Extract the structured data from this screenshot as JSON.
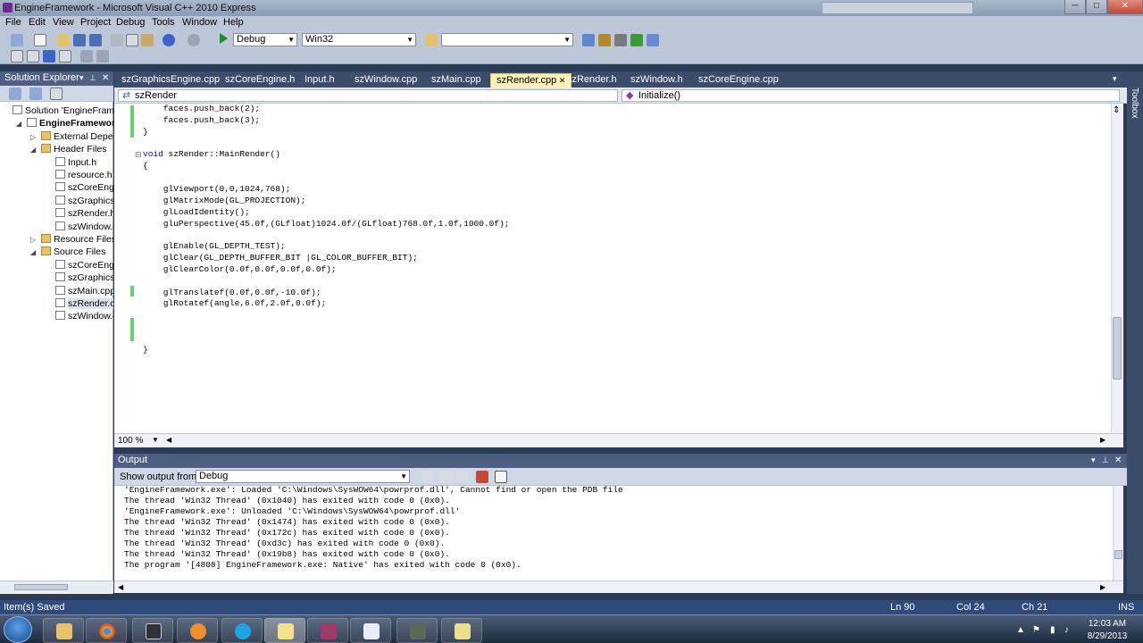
{
  "window": {
    "title": "EngineFramework - Microsoft Visual C++ 2010 Express",
    "min": "─",
    "max": "□",
    "close": "✕"
  },
  "menu": [
    "File",
    "Edit",
    "View",
    "Project",
    "Debug",
    "Tools",
    "Window",
    "Help"
  ],
  "toolbar": {
    "config": "Debug",
    "platform": "Win32",
    "find_value": ""
  },
  "solution_explorer": {
    "title": "Solution Explorer",
    "items": [
      {
        "label": "Solution 'EngineFrame",
        "level": 0,
        "folder": false
      },
      {
        "label": "EngineFramework",
        "level": 1,
        "folder": false
      },
      {
        "label": "External Depen",
        "level": 2,
        "folder": true
      },
      {
        "label": "Header Files",
        "level": 2,
        "folder": true
      },
      {
        "label": "Input.h",
        "level": 3,
        "folder": false
      },
      {
        "label": "resource.h",
        "level": 3,
        "folder": false
      },
      {
        "label": "szCoreEngi",
        "level": 3,
        "folder": false
      },
      {
        "label": "szGraphicsE",
        "level": 3,
        "folder": false
      },
      {
        "label": "szRender.h",
        "level": 3,
        "folder": false
      },
      {
        "label": "szWindow.h",
        "level": 3,
        "folder": false
      },
      {
        "label": "Resource Files",
        "level": 2,
        "folder": true
      },
      {
        "label": "Source Files",
        "level": 2,
        "folder": true
      },
      {
        "label": "szCoreEngi",
        "level": 3,
        "folder": false
      },
      {
        "label": "szGraphicsE",
        "level": 3,
        "folder": false
      },
      {
        "label": "szMain.cpp",
        "level": 3,
        "folder": false
      },
      {
        "label": "szRender.cp",
        "level": 3,
        "folder": false
      },
      {
        "label": "szWindow.c",
        "level": 3,
        "folder": false
      }
    ]
  },
  "tabs": [
    "szGraphicsEngine.cpp",
    "szCoreEngine.h",
    "Input.h",
    "szWindow.cpp",
    "szMain.cpp",
    "szRender.cpp",
    "szRender.h",
    "szWindow.h",
    "szCoreEngine.cpp"
  ],
  "active_tab": "szRender.cpp",
  "nav": {
    "class_scope": "szRender",
    "member_scope": "Initialize()"
  },
  "code_lines": [
    "    faces.push_back(2);",
    "    faces.push_back(3);",
    "}",
    "",
    "void szRender::MainRender()",
    "{",
    "",
    "    glViewport(0,0,1024,768);",
    "    glMatrixMode(GL_PROJECTION);",
    "    glLoadIdentity();",
    "    gluPerspective(45.0f,(GLfloat)1024.0f/(GLfloat)768.0f,1.0f,1000.0f);",
    "",
    "    glEnable(GL_DEPTH_TEST);",
    "    glClear(GL_DEPTH_BUFFER_BIT |GL_COLOR_BUFFER_BIT);",
    "    glClearColor(0.0f,0.0f,0.0f,0.0f);",
    "",
    "    glTranslatef(0.0f,0.0f,-10.0f);",
    "    glRotatef(angle,6.0f,2.0f,0.0f);",
    "",
    "",
    "",
    "}"
  ],
  "zoom": "100 %",
  "side_toolbox": "Toolbox",
  "output": {
    "title": "Output",
    "show_label": "Show output from:",
    "source": "Debug",
    "lines": [
      "'EngineFramework.exe': Loaded 'C:\\Windows\\SysWOW64\\powrprof.dll', Cannot find or open the PDB file",
      "The thread 'Win32 Thread' (0x1040) has exited with code 0 (0x0).",
      "'EngineFramework.exe': Unloaded 'C:\\Windows\\SysWOW64\\powrprof.dll'",
      "The thread 'Win32 Thread' (0x1474) has exited with code 0 (0x0).",
      "The thread 'Win32 Thread' (0x172c) has exited with code 0 (0x0).",
      "The thread 'Win32 Thread' (0xd3c) has exited with code 0 (0x0).",
      "The thread 'Win32 Thread' (0x19b8) has exited with code 0 (0x0).",
      "The program '[4808] EngineFramework.exe: Native' has exited with code 0 (0x0)."
    ]
  },
  "status": {
    "message": "Item(s) Saved",
    "ln": "Ln 90",
    "col": "Col 24",
    "ch": "Ch 21",
    "mode": "INS"
  },
  "taskbar": {
    "time": "12:03 AM",
    "date": "8/29/2013"
  },
  "colors": {
    "accent": "#4d6082",
    "active_tab": "#fff2b6",
    "change_bar": "#6ccf6c",
    "keyword": "#0000ff"
  }
}
